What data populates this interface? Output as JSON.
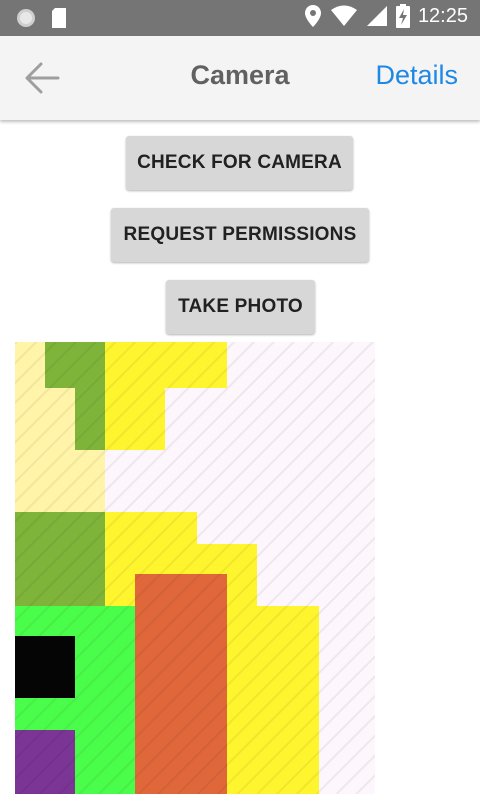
{
  "status_bar": {
    "time": "12:25",
    "icons": [
      "circle-icon",
      "sd-card-icon",
      "location-icon",
      "wifi-icon",
      "signal-icon",
      "battery-charging-icon"
    ]
  },
  "app_bar": {
    "title": "Camera",
    "details_label": "Details",
    "back_icon": "arrow-left-icon"
  },
  "buttons": {
    "check_camera": "CHECK FOR CAMERA",
    "request_permissions": "REQUEST PERMISSIONS",
    "take_photo": "TAKE PHOTO"
  },
  "photo": {
    "colors": {
      "lavender": "#fdf7fd",
      "cream": "#fff4a8",
      "olive": "#7fb43a",
      "yellow": "#fff52e",
      "green": "#4bfd4b",
      "orange": "#e0673a",
      "black": "#050505",
      "purple": "#7b3595"
    }
  }
}
